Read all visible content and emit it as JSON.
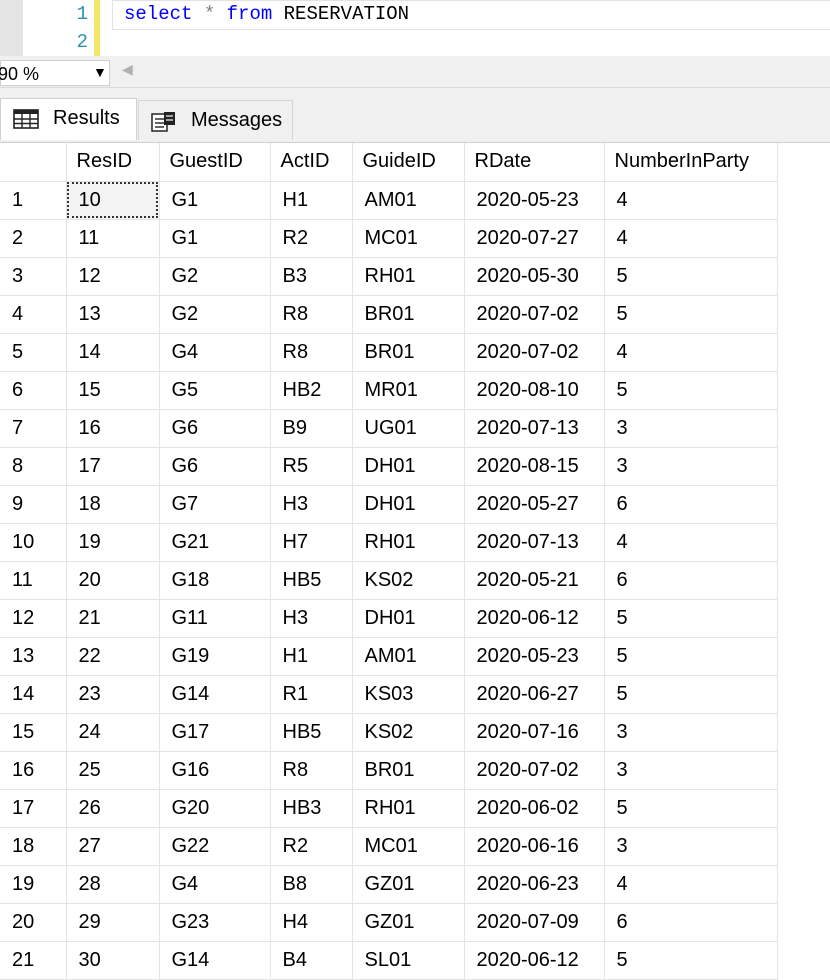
{
  "editor": {
    "line_numbers": [
      "1",
      "2"
    ],
    "code": {
      "kw1": "select",
      "op": "*",
      "kw2": "from",
      "table": "RESERVATION"
    }
  },
  "zoom": {
    "value": "90 %",
    "dropdown_icon": "chevron-down-icon",
    "scroll_icon": "chevron-left-icon"
  },
  "tabs": [
    {
      "label": "Results",
      "icon": "grid-icon"
    },
    {
      "label": "Messages",
      "icon": "messages-icon"
    }
  ],
  "grid": {
    "columns": [
      "",
      "ResID",
      "GuestID",
      "ActID",
      "GuideID",
      "RDate",
      "NumberInParty"
    ],
    "rows": [
      [
        "1",
        "10",
        "G1",
        "H1",
        "AM01",
        "2020-05-23",
        "4"
      ],
      [
        "2",
        "11",
        "G1",
        "R2",
        "MC01",
        "2020-07-27",
        "4"
      ],
      [
        "3",
        "12",
        "G2",
        "B3",
        "RH01",
        "2020-05-30",
        "5"
      ],
      [
        "4",
        "13",
        "G2",
        "R8",
        "BR01",
        "2020-07-02",
        "5"
      ],
      [
        "5",
        "14",
        "G4",
        "R8",
        "BR01",
        "2020-07-02",
        "4"
      ],
      [
        "6",
        "15",
        "G5",
        "HB2",
        "MR01",
        "2020-08-10",
        "5"
      ],
      [
        "7",
        "16",
        "G6",
        "B9",
        "UG01",
        "2020-07-13",
        "3"
      ],
      [
        "8",
        "17",
        "G6",
        "R5",
        "DH01",
        "2020-08-15",
        "3"
      ],
      [
        "9",
        "18",
        "G7",
        "H3",
        "DH01",
        "2020-05-27",
        "6"
      ],
      [
        "10",
        "19",
        "G21",
        "H7",
        "RH01",
        "2020-07-13",
        "4"
      ],
      [
        "11",
        "20",
        "G18",
        "HB5",
        "KS02",
        "2020-05-21",
        "6"
      ],
      [
        "12",
        "21",
        "G11",
        "H3",
        "DH01",
        "2020-06-12",
        "5"
      ],
      [
        "13",
        "22",
        "G19",
        "H1",
        "AM01",
        "2020-05-23",
        "5"
      ],
      [
        "14",
        "23",
        "G14",
        "R1",
        "KS03",
        "2020-06-27",
        "5"
      ],
      [
        "15",
        "24",
        "G17",
        "HB5",
        "KS02",
        "2020-07-16",
        "3"
      ],
      [
        "16",
        "25",
        "G16",
        "R8",
        "BR01",
        "2020-07-02",
        "3"
      ],
      [
        "17",
        "26",
        "G20",
        "HB3",
        "RH01",
        "2020-06-02",
        "5"
      ],
      [
        "18",
        "27",
        "G22",
        "R2",
        "MC01",
        "2020-06-16",
        "3"
      ],
      [
        "19",
        "28",
        "G4",
        "B8",
        "GZ01",
        "2020-06-23",
        "4"
      ],
      [
        "20",
        "29",
        "G23",
        "H4",
        "GZ01",
        "2020-07-09",
        "6"
      ],
      [
        "21",
        "30",
        "G14",
        "B4",
        "SL01",
        "2020-06-12",
        "5"
      ]
    ]
  }
}
